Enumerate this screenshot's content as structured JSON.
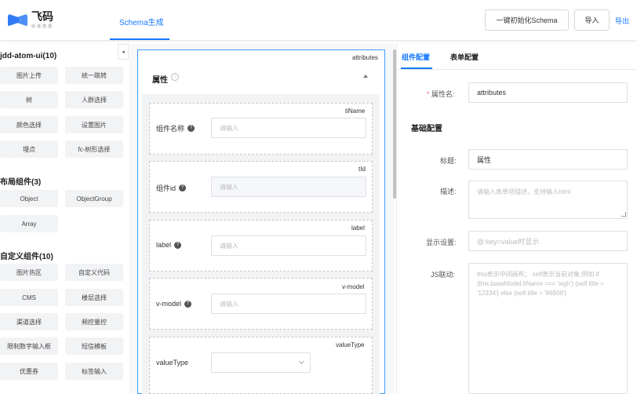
{
  "header": {
    "logo_title": "飞码",
    "logo_sub": "快速搭建",
    "tab": "Schema生成",
    "init_button": "一键初始化Schema",
    "import_button": "导入",
    "export_link": "导出"
  },
  "left": {
    "collapse_glyph": "◂",
    "groups": [
      {
        "title": "jdd-atom-ui(10)",
        "items": [
          "图片上传",
          "统一跳转",
          "树",
          "人群选择",
          "颜色选择",
          "设置图片",
          "埋点",
          "fc-树形选择"
        ]
      },
      {
        "title": "布局组件(3)",
        "items": [
          "Object",
          "ObjectGroup",
          "Array"
        ]
      },
      {
        "title": "自定义组件(10)",
        "items": [
          "图片热区",
          "自定义代码",
          "CMS",
          "楼层选择",
          "渠道选择",
          "频控量控",
          "限制数字输入框",
          "短信模板",
          "优惠券",
          "标签输入"
        ]
      }
    ]
  },
  "canvas": {
    "corner_label": "attributes",
    "section_title": "属性",
    "info_glyph": "i",
    "fields": [
      {
        "corner": "tiName",
        "label": "组件名称",
        "placeholder": "请输入",
        "type": "input"
      },
      {
        "corner": "tId",
        "label": "组件id",
        "placeholder": "请输入",
        "type": "disabled"
      },
      {
        "corner": "label",
        "label": "label",
        "placeholder": "请输入",
        "type": "input"
      },
      {
        "corner": "v-model",
        "label": "v-model",
        "placeholder": "请输入",
        "type": "input"
      },
      {
        "corner": "valueType",
        "label": "valueType",
        "placeholder": "",
        "type": "select"
      }
    ]
  },
  "right": {
    "tabs": [
      "组件配置",
      "表单配置"
    ],
    "prop_name_label": "属性名:",
    "prop_name_value": "attributes",
    "subsection": "基础配置",
    "title_label": "标题:",
    "title_value": "属性",
    "desc_label": "描述:",
    "desc_placeholder": "请输入表单项描述，支持输入html",
    "display_label": "显示设置:",
    "display_placeholder": "@:key=value时显示",
    "js_label": "JS联动:",
    "js_placeholder": "this表示中间画布； self表示当前对象;例如 if (this.baseModel.tiName === 'wgh') {self.title = '12334'} else {self.title = '86909'}"
  },
  "colors": {
    "accent": "#1677ff",
    "canvas_border": "#409eff",
    "required": "#f56c6c"
  }
}
